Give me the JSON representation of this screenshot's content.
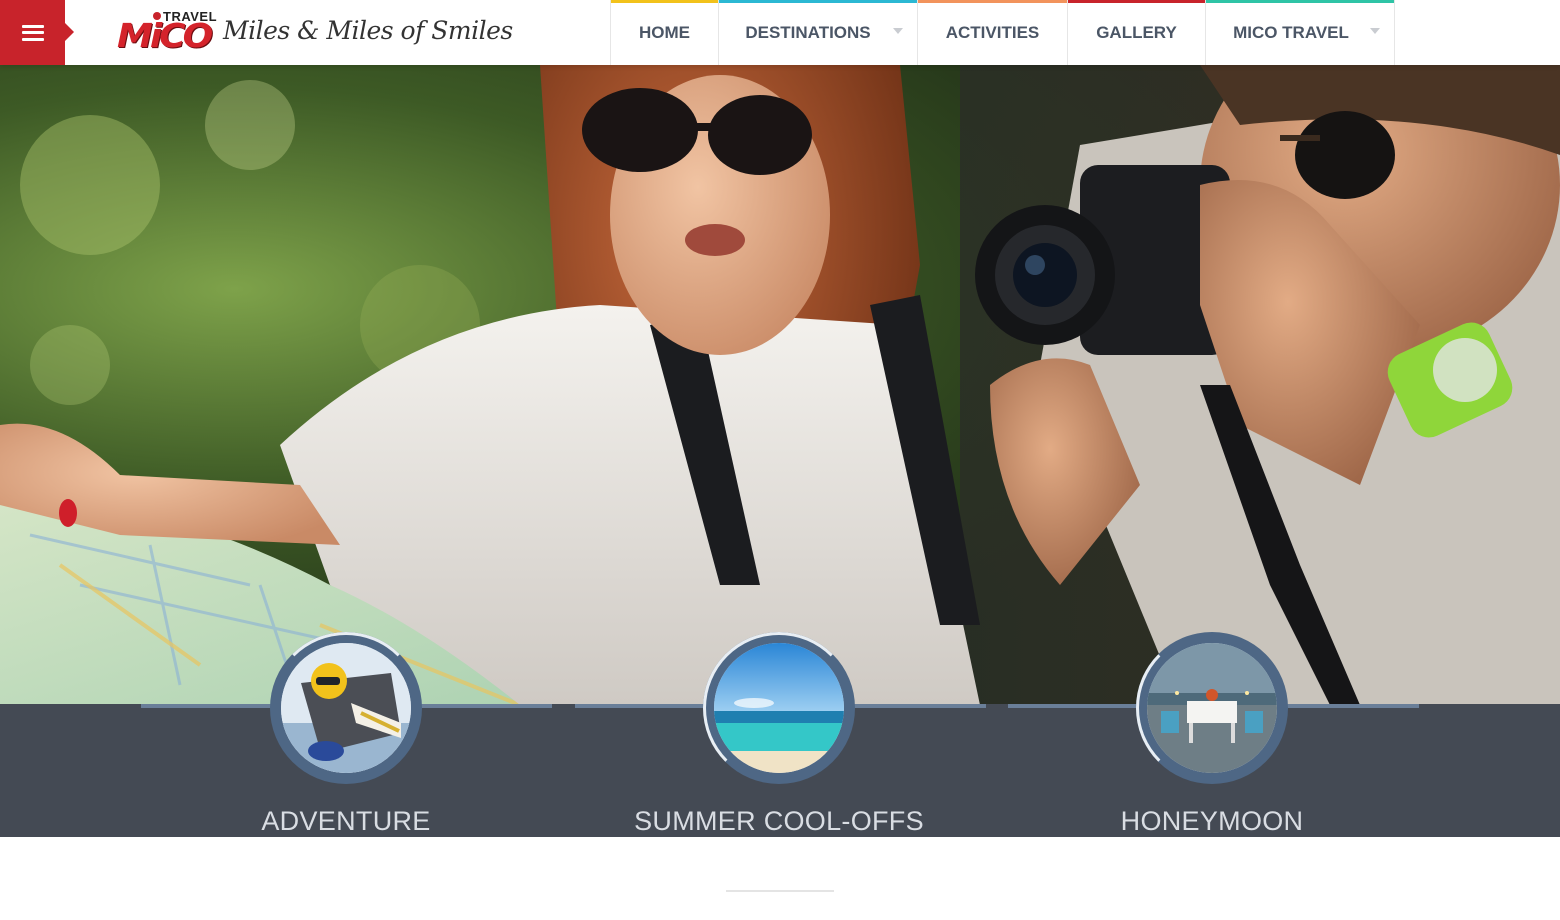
{
  "header": {
    "menu_icon": "hamburger-icon",
    "menu_color": "#c8232b",
    "logo": {
      "small_text": "TRAVEL",
      "brand": "MiCO",
      "tagline": "Miles & Miles of Smiles"
    },
    "nav": [
      {
        "label": "HOME",
        "accent": "#f2c21b",
        "has_dropdown": false
      },
      {
        "label": "DESTINATIONS",
        "accent": "#2bb8d3",
        "has_dropdown": true
      },
      {
        "label": "ACTIVITIES",
        "accent": "#f2935c",
        "has_dropdown": false
      },
      {
        "label": "GALLERY",
        "accent": "#c8232b",
        "has_dropdown": false
      },
      {
        "label": "MICO TRAVEL",
        "accent": "#2ec4a6",
        "has_dropdown": true
      }
    ]
  },
  "categories": [
    {
      "label": "ADVENTURE",
      "image": "skydiver-photo"
    },
    {
      "label": "SUMMER COOL-OFFS",
      "image": "beach-photo"
    },
    {
      "label": "HONEYMOON",
      "image": "beach-dinner-photo"
    }
  ],
  "colors": {
    "strip": "#444a54",
    "circle_ring": "#4e6785",
    "label": "#d9dde3"
  }
}
